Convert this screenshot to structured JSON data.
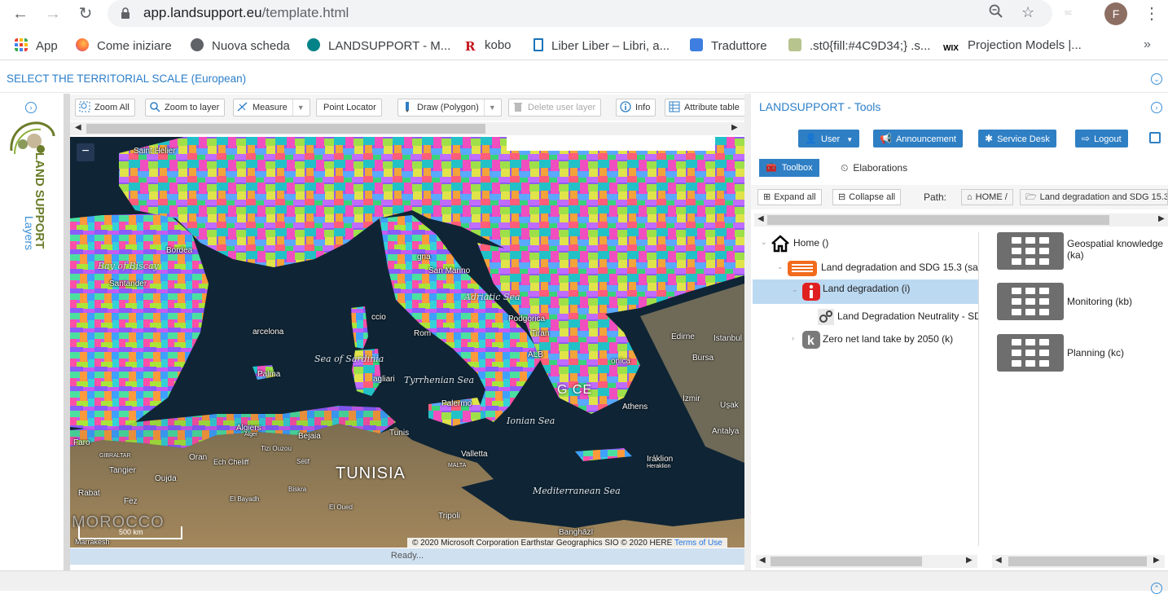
{
  "browser": {
    "url_host": "app.landsupport.eu",
    "url_path": "/template.html",
    "profile_initial": "F",
    "extension_label": "sc",
    "bookmarks": [
      {
        "label": "App",
        "icon": "apps-grid-icon",
        "color": "#e94235"
      },
      {
        "label": "Come iniziare",
        "icon": "firefox-icon",
        "color": "#ff7139"
      },
      {
        "label": "Nuova scheda",
        "icon": "globe-icon",
        "color": "#5f6368"
      },
      {
        "label": "LANDSUPPORT - M...",
        "icon": "sharepoint-icon",
        "color": "#038387"
      },
      {
        "label": "kobo",
        "icon": "kobo-icon",
        "color": "#c4121a"
      },
      {
        "label": "Liber Liber – Libri, a...",
        "icon": "liber-icon",
        "color": "#1a73b8"
      },
      {
        "label": "Traduttore",
        "icon": "translate-icon",
        "color": "#3d7ee0"
      },
      {
        "label": ".st0{fill:#4C9D34;} .s...",
        "icon": "svg-file-icon",
        "color": "#7a9a3a"
      },
      {
        "label": "Projection Models |...",
        "icon": "wix-icon",
        "color": "#000000"
      }
    ],
    "more_bookmarks": "»"
  },
  "header": {
    "territorial_title": "SELECT THE TERRITORIAL SCALE (European)"
  },
  "layers_panel": {
    "logo_text": "LAND SUPPORT",
    "label": "Layers"
  },
  "map_toolbar": {
    "zoom_all": "Zoom All",
    "zoom_to_layer": "Zoom to layer",
    "measure": "Measure",
    "point_locator": "Point Locator",
    "draw": "Draw (Polygon)",
    "delete_user_layer": "Delete user layer",
    "info": "Info",
    "attribute_table": "Attribute table"
  },
  "map": {
    "zoom_out": "−",
    "scale": "500 km",
    "attribution": "© 2020 Microsoft Corporation Earthstar Geographics SIO © 2020 HERE",
    "terms": "Terms of Use",
    "status": "Ready...",
    "labels": {
      "saint_helier": "Saint Helier",
      "bordeaux": "Bordea",
      "santander": "Santander",
      "barcelona": "arcelona",
      "palma": "Palma",
      "faro": "Faro",
      "tangier": "Tangier",
      "rabat": "Rabat",
      "fez": "Fez",
      "marrakesh": "Marrakesh",
      "oujda": "Oujda",
      "oran": "Oran",
      "algiers": "Algiers",
      "bejaia": "Bejaia",
      "tunis": "Tunis",
      "tripoli": "Tripoli",
      "valletta": "Valletta",
      "palermo": "Palermo",
      "cagliari": "agliari",
      "ajaccio": "ccio",
      "rome": "Rom",
      "san_marino": "San Marino",
      "bologna": "gna",
      "podgorica": "Podgorica",
      "tirana": "Tiran",
      "alb": "ALB",
      "athens": "Athens",
      "izmir": "İzmir",
      "usak": "Uşak",
      "antalya": "Antalya",
      "iraklion": "Iráklion",
      "edirne": "Edirne",
      "istanbul": "Istanbul",
      "bursa": "Bursa",
      "benghazi": "Banghāzī",
      "el_oued": "El Oued",
      "biskra": "Biskra",
      "el_bayadh": "El Bayadh",
      "ech_cheliff": "Ech Cheliff",
      "tizi_ouzou": "Tizi Ouzou",
      "setif": "Sétif",
      "gibraltar": "GIBRALTAR",
      "malta": "MALTA",
      "heraklion": "Heraklion",
      "alger": "Alger",
      "greece": "G         CE",
      "onica": "onica"
    },
    "seas": {
      "biscay": "Bay of Biscay",
      "sardinia": "Sea of Sardinia",
      "tyrrhenian": "Tyrrhenian Sea",
      "ionian": "Ionian Sea",
      "adriatic": "Adriatic Sea",
      "mediterranean": "Mediterranean Sea"
    },
    "countries": {
      "tunisia": "TUNISIA",
      "morocco": "MOROCCO"
    }
  },
  "tools": {
    "title": "LANDSUPPORT - Tools",
    "buttons": {
      "user": "User",
      "announcement": "Announcement",
      "service_desk": "Service Desk",
      "logout": "Logout"
    },
    "tabs": {
      "toolbox": "Toolbox",
      "elaborations": "Elaborations"
    },
    "expand_all": "Expand all",
    "collapse_all": "Collapse all",
    "path_label": "Path:",
    "path_home": "HOME /",
    "path_current": "Land degradation and SDG 15.3",
    "tree": [
      {
        "label": "Home ()"
      },
      {
        "label": "Land degradation and SDG 15.3 (sa"
      },
      {
        "label": "Land degradation (i)"
      },
      {
        "label": "Land Degradation Neutrality - SD"
      },
      {
        "label": "Zero net land take by 2050 (k)"
      }
    ],
    "cards": [
      {
        "label": "Geospatial knowledge (ka)"
      },
      {
        "label": "Monitoring (kb)"
      },
      {
        "label": "Planning (kc)"
      }
    ]
  },
  "colors": {
    "accent_blue": "#2f7fc4",
    "title_blue": "#2c7fc9",
    "selected_row": "#bcd9f2"
  }
}
